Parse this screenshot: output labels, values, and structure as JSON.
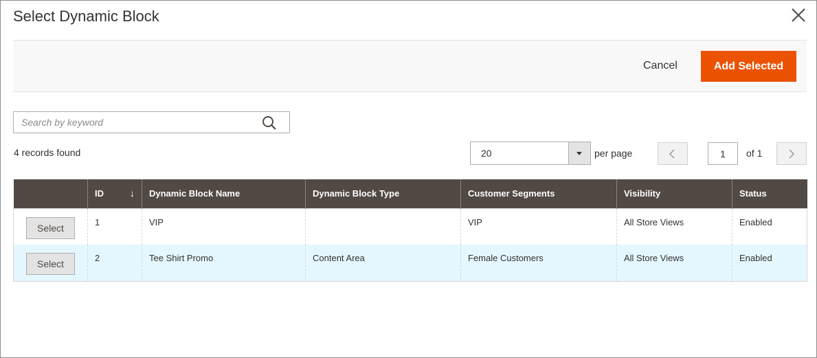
{
  "modal": {
    "title": "Select Dynamic Block"
  },
  "toolbar": {
    "cancel_label": "Cancel",
    "add_label": "Add Selected"
  },
  "search": {
    "placeholder": "Search by keyword",
    "value": ""
  },
  "records": {
    "text": "4 records found"
  },
  "pagination": {
    "per_page_value": "20",
    "per_page_label": "per page",
    "current_page": "1",
    "of_label": "of 1"
  },
  "colors": {
    "header_bg": "#514943",
    "accent": "#eb5202",
    "row_highlight": "#e5f7fe"
  },
  "grid": {
    "columns": [
      "",
      "ID",
      "Dynamic Block Name",
      "Dynamic Block Type",
      "Customer Segments",
      "Visibility",
      "Status"
    ],
    "sort_indicator": "↓",
    "rows": [
      {
        "action": "Select",
        "id": "1",
        "name": "VIP",
        "type": "",
        "segments": "VIP",
        "visibility": "All Store Views",
        "status": "Enabled"
      },
      {
        "action": "Select",
        "id": "2",
        "name": "Tee Shirt Promo",
        "type": "Content Area",
        "segments": "Female Customers",
        "visibility": "All Store Views",
        "status": "Enabled"
      }
    ]
  }
}
